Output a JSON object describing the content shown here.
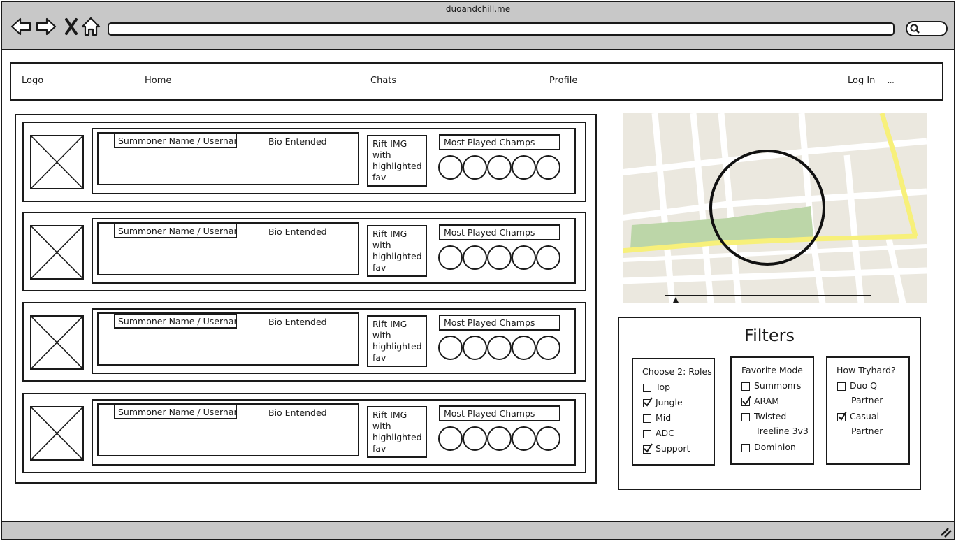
{
  "browser": {
    "title": "duoandchill.me",
    "icons": [
      "back-arrow-icon",
      "forward-arrow-icon",
      "close-x-icon",
      "home-icon",
      "search-icon",
      "resize-grip-icon"
    ]
  },
  "nav": {
    "logo": "Logo",
    "home": "Home",
    "chats": "Chats",
    "profile": "Profile",
    "login": "Log In",
    "more": "..."
  },
  "results": [
    {
      "name": "Summoner Name / Usernam",
      "bio": "Bio Entended",
      "rift": "Rift IMG with highlighted fav",
      "champs_label": "Most Played Champs",
      "champ_count": 5
    },
    {
      "name": "Summoner Name / Usernam",
      "bio": "Bio Entended",
      "rift": "Rift IMG with highlighted fav",
      "champs_label": "Most Played Champs",
      "champ_count": 5
    },
    {
      "name": "Summoner Name / Usernam",
      "bio": "Bio Entended",
      "rift": "Rift IMG with highlighted fav",
      "champs_label": "Most Played Champs",
      "champ_count": 5
    },
    {
      "name": "Summoner Name / Usernam",
      "bio": "Bio Entended",
      "rift": "Rift IMG with highlighted fav",
      "champs_label": "Most Played Champs",
      "champ_count": 5
    }
  ],
  "map": {
    "road_color": "#f7f07a",
    "park_color": "#bcd6a8",
    "ground_color": "#ebe8df",
    "radius_slider_value": 0.05
  },
  "filters": {
    "title": "Filters",
    "roles": {
      "heading": "Choose 2: Roles",
      "options": [
        {
          "label": "Top",
          "checked": false
        },
        {
          "label": "Jungle",
          "checked": true
        },
        {
          "label": "Mid",
          "checked": false
        },
        {
          "label": "ADC",
          "checked": false
        },
        {
          "label": "Support",
          "checked": true
        }
      ]
    },
    "mode": {
      "heading": "Favorite Mode",
      "options": [
        {
          "label": "Summonrs",
          "checked": false
        },
        {
          "label": "ARAM",
          "checked": true
        },
        {
          "label": "Twisted",
          "label2": "Treeline 3v3",
          "checked": false
        },
        {
          "label": "Dominion",
          "checked": false
        }
      ]
    },
    "tryhard": {
      "heading": "How Tryhard?",
      "options": [
        {
          "label": "Duo Q",
          "label2": "Partner",
          "checked": false
        },
        {
          "label": "Casual",
          "label2": "Partner",
          "checked": true
        }
      ]
    }
  }
}
